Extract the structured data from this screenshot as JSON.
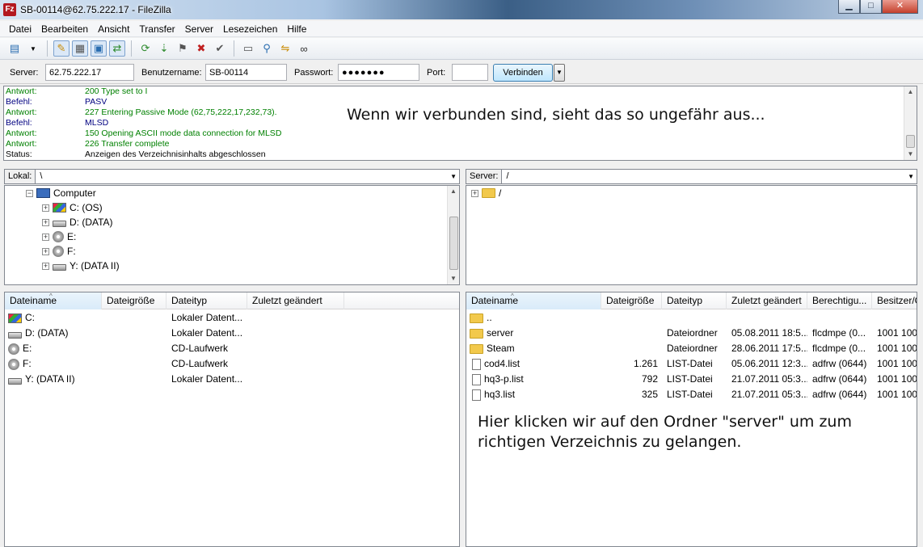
{
  "window": {
    "title": "SB-00114@62.75.222.17 - FileZilla",
    "app_icon": "Fz"
  },
  "menu": [
    "Datei",
    "Bearbeiten",
    "Ansicht",
    "Transfer",
    "Server",
    "Lesezeichen",
    "Hilfe"
  ],
  "toolbar": {
    "icons": [
      "site-manager-icon",
      "dropdown-arrow-icon",
      "toggle-log-icon",
      "toggle-local-tree-icon",
      "toggle-remote-tree-icon",
      "toggle-queue-icon",
      "refresh-icon",
      "process-queue-icon",
      "cancel-icon",
      "disconnect-icon",
      "reconnect-icon",
      "directory-listing-filter-icon",
      "compare-directories-icon",
      "sync-browsing-icon",
      "search-icon"
    ]
  },
  "quickconnect": {
    "server_label": "Server:",
    "server_value": "62.75.222.17",
    "user_label": "Benutzername:",
    "user_value": "SB-00114",
    "password_label": "Passwort:",
    "password_value": "●●●●●●●",
    "port_label": "Port:",
    "port_value": "",
    "connect_label": "Verbinden"
  },
  "log": {
    "rows": [
      {
        "kind": "Antwort:",
        "text": "200 Type set to I",
        "color": "green"
      },
      {
        "kind": "Befehl:",
        "text": "PASV",
        "color": "navy"
      },
      {
        "kind": "Antwort:",
        "text": "227 Entering Passive Mode (62,75,222,17,232,73).",
        "color": "green"
      },
      {
        "kind": "Befehl:",
        "text": "MLSD",
        "color": "navy"
      },
      {
        "kind": "Antwort:",
        "text": "150 Opening ASCII mode data connection for MLSD",
        "color": "green"
      },
      {
        "kind": "Antwort:",
        "text": "226 Transfer complete",
        "color": "green"
      },
      {
        "kind": "Status:",
        "text": "Anzeigen des Verzeichnisinhalts abgeschlossen",
        "color": "black"
      }
    ],
    "annotation": "Wenn wir verbunden sind, sieht das so ungefähr aus..."
  },
  "local": {
    "path_label": "Lokal:",
    "path_value": "\\",
    "tree": [
      {
        "label": "Computer",
        "icon": "computer-icon",
        "expander": "−"
      },
      {
        "label": "C: (OS)",
        "icon": "os-drive-icon",
        "expander": "+"
      },
      {
        "label": "D: (DATA)",
        "icon": "drive-icon",
        "expander": "+"
      },
      {
        "label": "E:",
        "icon": "cd-drive-icon",
        "expander": "+"
      },
      {
        "label": "F:",
        "icon": "cd-drive-icon",
        "expander": "+"
      },
      {
        "label": "Y: (DATA II)",
        "icon": "drive-icon",
        "expander": "+"
      }
    ],
    "columns": [
      "Dateiname",
      "Dateigröße",
      "Dateityp",
      "Zuletzt geändert"
    ],
    "files": [
      {
        "name": "C:",
        "icon": "os-drive-icon",
        "size": "",
        "type": "Lokaler Datent...",
        "modified": ""
      },
      {
        "name": "D: (DATA)",
        "icon": "drive-icon",
        "size": "",
        "type": "Lokaler Datent...",
        "modified": ""
      },
      {
        "name": "E:",
        "icon": "cd-drive-icon",
        "size": "",
        "type": "CD-Laufwerk",
        "modified": ""
      },
      {
        "name": "F:",
        "icon": "cd-drive-icon",
        "size": "",
        "type": "CD-Laufwerk",
        "modified": ""
      },
      {
        "name": "Y: (DATA II)",
        "icon": "drive-icon",
        "size": "",
        "type": "Lokaler Datent...",
        "modified": ""
      }
    ]
  },
  "remote": {
    "path_label": "Server:",
    "path_value": "/",
    "tree": [
      {
        "label": "/",
        "icon": "folder-icon",
        "expander": "+"
      }
    ],
    "columns": [
      "Dateiname",
      "Dateigröße",
      "Dateityp",
      "Zuletzt geändert",
      "Berechtigu...",
      "Besitzer/G"
    ],
    "files": [
      {
        "name": "..",
        "icon": "folder-icon",
        "size": "",
        "type": "",
        "modified": "",
        "perms": "",
        "owner": ""
      },
      {
        "name": "server",
        "icon": "folder-icon",
        "size": "",
        "type": "Dateiordner",
        "modified": "05.08.2011 18:5...",
        "perms": "flcdmpe (0...",
        "owner": "1001 100"
      },
      {
        "name": "Steam",
        "icon": "folder-icon",
        "size": "",
        "type": "Dateiordner",
        "modified": "28.06.2011 17:5...",
        "perms": "flcdmpe (0...",
        "owner": "1001 100"
      },
      {
        "name": "cod4.list",
        "icon": "file-icon",
        "size": "1.261",
        "type": "LIST-Datei",
        "modified": "05.06.2011 12:3...",
        "perms": "adfrw (0644)",
        "owner": "1001 100"
      },
      {
        "name": "hq3-p.list",
        "icon": "file-icon",
        "size": "792",
        "type": "LIST-Datei",
        "modified": "21.07.2011 05:3...",
        "perms": "adfrw (0644)",
        "owner": "1001 100"
      },
      {
        "name": "hq3.list",
        "icon": "file-icon",
        "size": "325",
        "type": "LIST-Datei",
        "modified": "21.07.2011 05:3...",
        "perms": "adfrw (0644)",
        "owner": "1001 100"
      }
    ],
    "annotation": "Hier klicken wir auf den Ordner \"server\" um zum richtigen Verzeichnis zu gelangen."
  }
}
